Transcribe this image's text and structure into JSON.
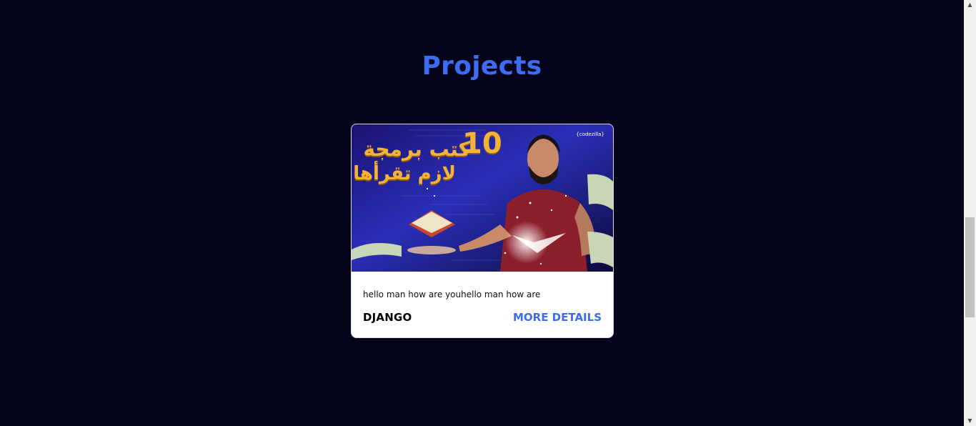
{
  "section": {
    "title": "Projects"
  },
  "card": {
    "thumbnail": {
      "number": "10",
      "line1": "كتب برمجة",
      "line2": "لازم تقرأها",
      "brand": "{codezilla}"
    },
    "description": "hello man how are youhello man how are",
    "tag": "DJANGO",
    "more_label": "MORE DETAILS"
  },
  "colors": {
    "background": "#03031a",
    "accent": "#3d6bf2",
    "thumb_text": "#f4b338"
  },
  "icons": {
    "scroll_up": "scroll-up-arrow-icon",
    "scroll_down": "scroll-down-arrow-icon"
  }
}
